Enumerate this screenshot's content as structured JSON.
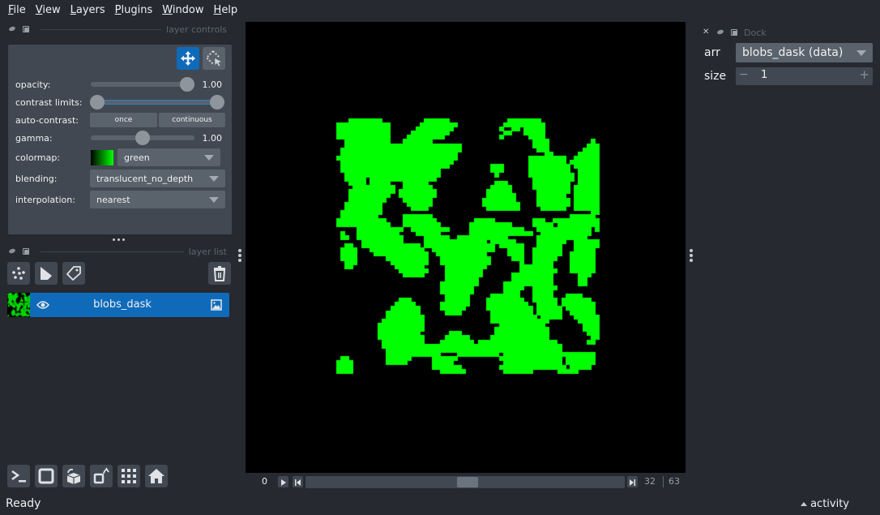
{
  "menu": [
    {
      "label": "File",
      "mnemonic": "F",
      "rest": "ile"
    },
    {
      "label": "View",
      "mnemonic": "V",
      "rest": "iew"
    },
    {
      "label": "Layers",
      "mnemonic": "L",
      "rest": "ayers"
    },
    {
      "label": "Plugins",
      "mnemonic": "P",
      "rest": "lugins"
    },
    {
      "label": "Window",
      "mnemonic": "W",
      "rest": "indow"
    },
    {
      "label": "Help",
      "mnemonic": "H",
      "rest": "elp"
    }
  ],
  "layer_controls": {
    "title": "layer controls",
    "opacity": {
      "label": "opacity:",
      "value": "1.00",
      "fraction": 1.0
    },
    "contrast_limits": {
      "label": "contrast limits:",
      "low_fraction": 0.0,
      "high_fraction": 1.0
    },
    "auto_contrast": {
      "label": "auto-contrast:",
      "once": "once",
      "continuous": "continuous"
    },
    "gamma": {
      "label": "gamma:",
      "value": "1.00",
      "fraction": 0.5
    },
    "colormap": {
      "label": "colormap:",
      "value": "green"
    },
    "blending": {
      "label": "blending:",
      "value": "translucent_no_depth"
    },
    "interpolation": {
      "label": "interpolation:",
      "value": "nearest"
    }
  },
  "layer_list": {
    "title": "layer list",
    "layers": [
      {
        "name": "blobs_dask",
        "visible": true,
        "type": "image",
        "selected": true
      }
    ]
  },
  "dock": {
    "title": "Dock",
    "arr_label": "arr",
    "arr_value": "blobs_dask (data)",
    "size_label": "size",
    "size_value": "1",
    "minus": "−",
    "plus": "+"
  },
  "dims": {
    "axis_label": "0",
    "current": "32",
    "max": "63",
    "fraction": 0.508
  },
  "status": {
    "text": "Ready",
    "activity": "activity"
  },
  "colors": {
    "accent": "#0f6bba",
    "blob": "#00ff00",
    "background": "#262930",
    "panel": "#414851"
  },
  "image_mask": [
    "................................................................",
    "....########..........######..............########..............",
    ".#############.......#########...........##########.............",
    ".#############......#########...........#..##.#####.............",
    ".#############.....#########.............##...#####.............",
    ".#############....#########.............#......####.............",
    "...###########...#######........................####..........#.",
    "...############################.................####.........###",
    "..#############################..................###........####",
    "..############################.....................##......#####",
    ".#############################.................#########..######",
    "..###########################..................#########.#######",
    "..##########################..........###......##########.######",
    "..########################............###......##########..#####",
    "...#######################.............#.......###########.#####",
    "...#####.################.......................##########.#####",
    "....####.#####...######................###......#########..#####",
    ".....##########..#######..............#####.....#########.######",
    "....###########.#########............######......########.######",
    "....##########..#########............#######.....#######..######",
    "....#########....#######............########.....########.######",
    "...#########......######............#########....########.######",
    "...#########.......####..............########.....######..######",
    "..##########..................................................##",
    "..#########......#######.................................######",
    ".############....########.........#####.........###..###########",
    ".#############...#########.......##########.....#####.##########",
    "......###########..#########.....#############...#############.#",
    "..#...##########....######.......###############..############..",
    "..##..###########.....######..############.......############...",
    ".......##########.....###############.######.....#######..######",
    "...##..##############.#################.######...######...######",
    "..####...#############..###############...####..#######...#####.",
    "..####....#############..############.....####..#######..######.",
    "..####.......##########...############.....###..######...######.",
    "...###........#########...############.......#..#####....######.",
    "...##..........#######.....##########........########....######.",
    "................#######....#########.........#########...######.",
    ".................#####.....#########.......##########......###..",
    "...........................########........##########......##...",
    "..........................#########......############......##...",
    "..........................########.......#####..######..........",
    "..........................########.......####...#####..........",
    "...........................######.....#######...#####...####....",
    "................###........######....#########..######.#######..",
    "...............#####......#######....##########..#####.########.",
    "..............#######.....######.....###########.######.#######.",
    ".............########......####.......##########.######..######.",
    ".............#########................###########.#####...######",
    "............##########................##############.......#####",
    "...........###########..................###########.........####",
    "...........###########.................#############........####",
    "...........##########.......###........#############.........###",
    "...........###########.....######.....##############..........##",
    "............##########....########.###################.......##.",
    "............###########################################.........",
    ".............##########################################.........",
    ".............#############....##########.######################.",
    "..##.........######.....######..........###############.#######.",
    ".####........#####......#####............##############.#######.",
    ".####...................#######.........################.#####..",
    ".####.....................######.........#######......#####.....",
    "................................................................",
    "................................................................"
  ]
}
